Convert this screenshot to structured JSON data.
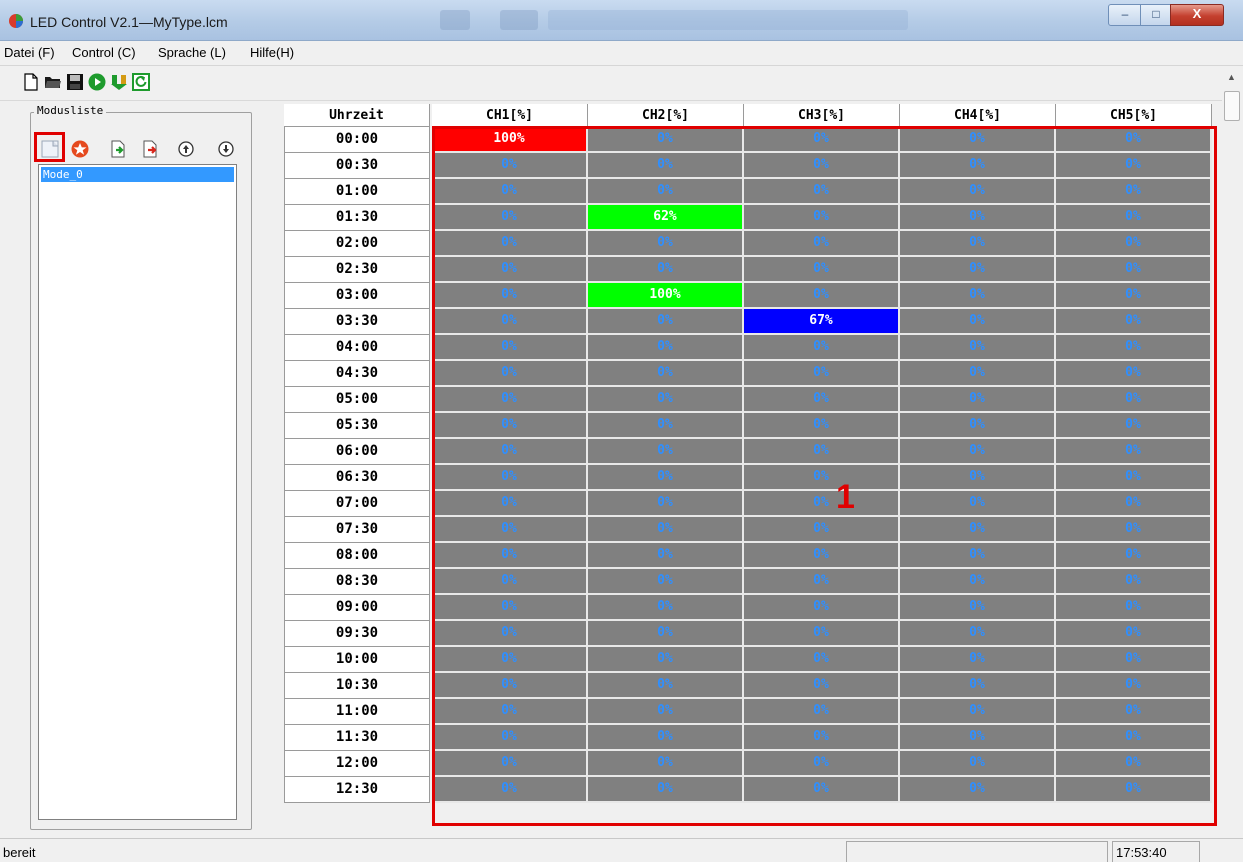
{
  "window": {
    "title": "LED Control V2.1—MyType.lcm",
    "controls": {
      "minimize": "–",
      "maximize": "□",
      "close": "X"
    }
  },
  "menu": [
    {
      "label": "Datei (F)"
    },
    {
      "label": "Control (C)"
    },
    {
      "label": "Sprache (L)"
    },
    {
      "label": "Hilfe(H)"
    }
  ],
  "toolbar": {
    "buttons": [
      "new-file-icon",
      "open-folder-icon",
      "save-disk-icon",
      "play-icon",
      "download-icon",
      "reset-icon"
    ]
  },
  "mode_panel": {
    "title": "Modusliste",
    "buttons": [
      "new-mode-icon",
      "delete-mode-icon",
      "import-mode-icon",
      "export-mode-icon",
      "move-up-icon",
      "move-down-icon"
    ],
    "items": [
      {
        "label": "Mode_0",
        "selected": true
      }
    ]
  },
  "grid": {
    "headers": [
      "Uhrzeit",
      "CH1[%]",
      "CH2[%]",
      "CH3[%]",
      "CH4[%]",
      "CH5[%]"
    ],
    "rows": [
      {
        "time": "00:00",
        "values": [
          "100%",
          "0%",
          "0%",
          "0%",
          "0%"
        ]
      },
      {
        "time": "00:30",
        "values": [
          "0%",
          "0%",
          "0%",
          "0%",
          "0%"
        ]
      },
      {
        "time": "01:00",
        "values": [
          "0%",
          "0%",
          "0%",
          "0%",
          "0%"
        ]
      },
      {
        "time": "01:30",
        "values": [
          "0%",
          "62%",
          "0%",
          "0%",
          "0%"
        ]
      },
      {
        "time": "02:00",
        "values": [
          "0%",
          "0%",
          "0%",
          "0%",
          "0%"
        ]
      },
      {
        "time": "02:30",
        "values": [
          "0%",
          "0%",
          "0%",
          "0%",
          "0%"
        ]
      },
      {
        "time": "03:00",
        "values": [
          "0%",
          "100%",
          "0%",
          "0%",
          "0%"
        ]
      },
      {
        "time": "03:30",
        "values": [
          "0%",
          "0%",
          "67%",
          "0%",
          "0%"
        ]
      },
      {
        "time": "04:00",
        "values": [
          "0%",
          "0%",
          "0%",
          "0%",
          "0%"
        ]
      },
      {
        "time": "04:30",
        "values": [
          "0%",
          "0%",
          "0%",
          "0%",
          "0%"
        ]
      },
      {
        "time": "05:00",
        "values": [
          "0%",
          "0%",
          "0%",
          "0%",
          "0%"
        ]
      },
      {
        "time": "05:30",
        "values": [
          "0%",
          "0%",
          "0%",
          "0%",
          "0%"
        ]
      },
      {
        "time": "06:00",
        "values": [
          "0%",
          "0%",
          "0%",
          "0%",
          "0%"
        ]
      },
      {
        "time": "06:30",
        "values": [
          "0%",
          "0%",
          "0%",
          "0%",
          "0%"
        ]
      },
      {
        "time": "07:00",
        "values": [
          "0%",
          "0%",
          "0%",
          "0%",
          "0%"
        ]
      },
      {
        "time": "07:30",
        "values": [
          "0%",
          "0%",
          "0%",
          "0%",
          "0%"
        ]
      },
      {
        "time": "08:00",
        "values": [
          "0%",
          "0%",
          "0%",
          "0%",
          "0%"
        ]
      },
      {
        "time": "08:30",
        "values": [
          "0%",
          "0%",
          "0%",
          "0%",
          "0%"
        ]
      },
      {
        "time": "09:00",
        "values": [
          "0%",
          "0%",
          "0%",
          "0%",
          "0%"
        ]
      },
      {
        "time": "09:30",
        "values": [
          "0%",
          "0%",
          "0%",
          "0%",
          "0%"
        ]
      },
      {
        "time": "10:00",
        "values": [
          "0%",
          "0%",
          "0%",
          "0%",
          "0%"
        ]
      },
      {
        "time": "10:30",
        "values": [
          "0%",
          "0%",
          "0%",
          "0%",
          "0%"
        ]
      },
      {
        "time": "11:00",
        "values": [
          "0%",
          "0%",
          "0%",
          "0%",
          "0%"
        ]
      },
      {
        "time": "11:30",
        "values": [
          "0%",
          "0%",
          "0%",
          "0%",
          "0%"
        ]
      },
      {
        "time": "12:00",
        "values": [
          "0%",
          "0%",
          "0%",
          "0%",
          "0%"
        ]
      },
      {
        "time": "12:30",
        "values": [
          "0%",
          "0%",
          "0%",
          "0%",
          "0%"
        ]
      }
    ],
    "active_cells": [
      {
        "row": 0,
        "channel": 0,
        "color": "#ff0000"
      },
      {
        "row": 3,
        "channel": 1,
        "color": "#00ff00"
      },
      {
        "row": 6,
        "channel": 1,
        "color": "#00ff00"
      },
      {
        "row": 7,
        "channel": 2,
        "color": "#0000ff"
      }
    ],
    "colors": {
      "inactive_cell": "#808080",
      "inactive_text": "#2f8fff",
      "active_text": "#ffffff"
    }
  },
  "annotation": {
    "label": "1",
    "color": "#e00000"
  },
  "status": {
    "text": "bereit",
    "time": "17:53:40"
  }
}
